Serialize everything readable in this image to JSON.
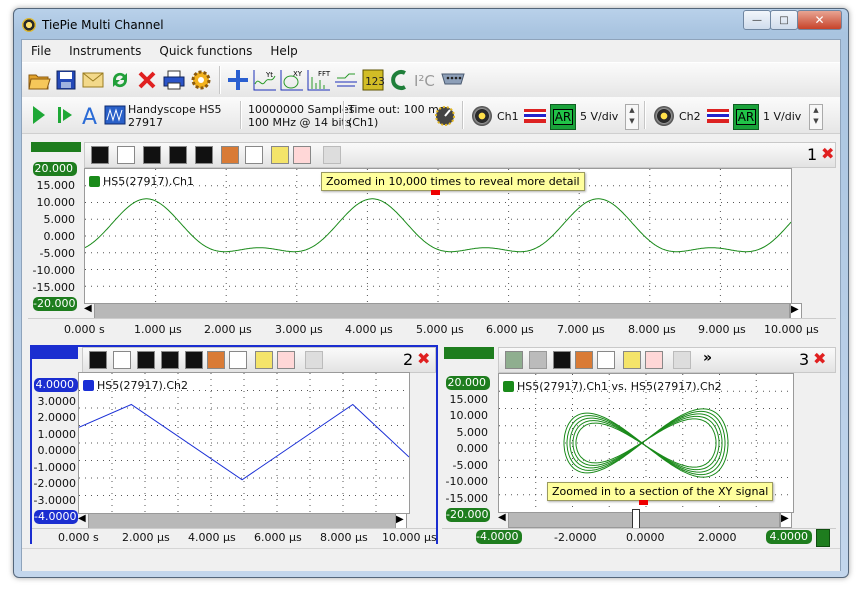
{
  "window": {
    "title": "TiePie Multi Channel"
  },
  "menu": [
    "File",
    "Instruments",
    "Quick functions",
    "Help"
  ],
  "toolbar2": {
    "device_name": "Handyscope HS5",
    "device_serial": "27917",
    "samples": "10000000 Samples",
    "rate": "100 MHz @ 14 bits",
    "timeout": "Time out: 100 ms",
    "timeout_ch": "(Ch1)",
    "ch1_label": "Ch1",
    "ch1_vdiv": "5 V/div",
    "ch2_label": "Ch2",
    "ch2_vdiv": "1 V/div",
    "ar_label": "AR"
  },
  "colors": {
    "ch1": "#1a8a1a",
    "ch2": "#1a2fd6",
    "accent_green": "#1e7d1e",
    "accent_blue": "#1b2ed0"
  },
  "panel1": {
    "number": "1",
    "legend": "HS5(27917).Ch1",
    "tooltip": "Zoomed in 10,000 times to reveal more detail",
    "y_ticks": [
      "20.000",
      "15.000",
      "10.000",
      "5.000",
      "0.000",
      "-5.000",
      "-10.000",
      "-15.000",
      "-20.000"
    ],
    "x_ticks": [
      "0.000 s",
      "1.000 µs",
      "2.000 µs",
      "3.000 µs",
      "4.000 µs",
      "5.000 µs",
      "6.000 µs",
      "7.000 µs",
      "8.000 µs",
      "9.000 µs",
      "10.000 µs"
    ]
  },
  "panel2": {
    "number": "2",
    "legend": "HS5(27917).Ch2",
    "y_ticks": [
      "4.0000",
      "3.0000",
      "2.0000",
      "1.0000",
      "0.0000",
      "-1.0000",
      "-2.0000",
      "-3.0000",
      "-4.0000"
    ],
    "x_ticks": [
      "0.000 s",
      "2.000 µs",
      "4.000 µs",
      "6.000 µs",
      "8.000 µs",
      "10.000 µs"
    ]
  },
  "panel3": {
    "number": "3",
    "legend": "HS5(27917).Ch1 vs. HS5(27917).Ch2",
    "tooltip": "Zoomed in to a section of the XY signal",
    "more": "»",
    "y_ticks": [
      "20.000",
      "15.000",
      "10.000",
      "5.000",
      "0.000",
      "-5.000",
      "-10.000",
      "-15.000",
      "-20.000"
    ],
    "x_ticks": [
      "-4.0000",
      "-2.0000",
      "0.0000",
      "2.0000",
      "4.0000"
    ]
  }
}
